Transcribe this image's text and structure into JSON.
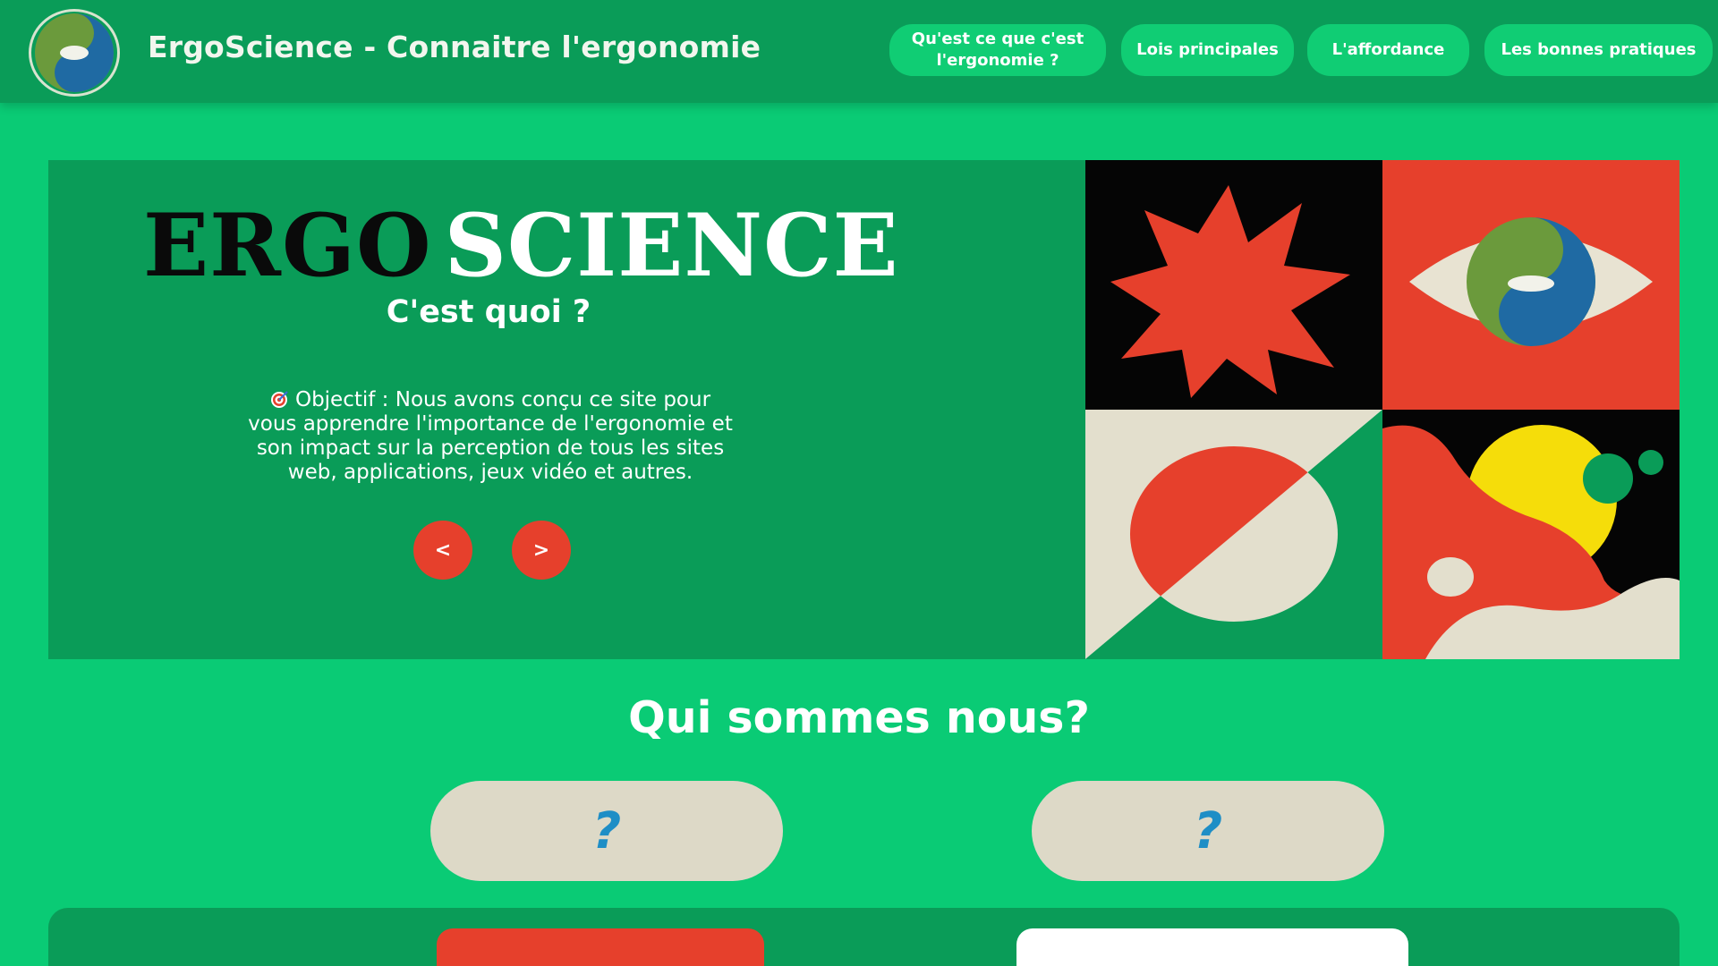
{
  "header": {
    "site_title": "ErgoScience - Connaitre l'ergonomie",
    "logo_icon": "yin-yang-eye-logo-icon",
    "nav": [
      {
        "label_line1": "Qu'est ce que c'est",
        "label_line2": "l'ergonomie ?"
      },
      {
        "label": "Lois principales"
      },
      {
        "label": "L'affordance"
      },
      {
        "label": "Les bonnes pratiques"
      }
    ]
  },
  "hero": {
    "brand_part1": "ERGO",
    "brand_part2": "SCIENCE",
    "subtitle": "C'est quoi ?",
    "objective_icon": "target-icon",
    "objective_lines": [
      "Objectif : Nous avons conçu ce site pour",
      "vous apprendre l'importance de l'ergonomie et",
      "son impact sur la perception de tous les sites",
      "web, applications, jeux vidéo et autres."
    ],
    "prev_label": "<",
    "next_label": ">",
    "art_icons": [
      "starburst-icon",
      "eye-icon",
      "split-circle-icon",
      "abstract-planet-icon"
    ]
  },
  "about": {
    "title": "Qui sommes nous?",
    "members": [
      {
        "label": "?"
      },
      {
        "label": "?"
      }
    ]
  },
  "colors": {
    "page_bg": "#0acb75",
    "dark_green": "#0a9c58",
    "nav_button": "#10cd74",
    "accent_red": "#e6402c",
    "pill_beige": "#ddd9c7",
    "question_blue": "#1e8ec6",
    "logo_green": "#6b9a3c",
    "logo_blue": "#1f6aa3",
    "art_yellow": "#f5dd0a"
  }
}
